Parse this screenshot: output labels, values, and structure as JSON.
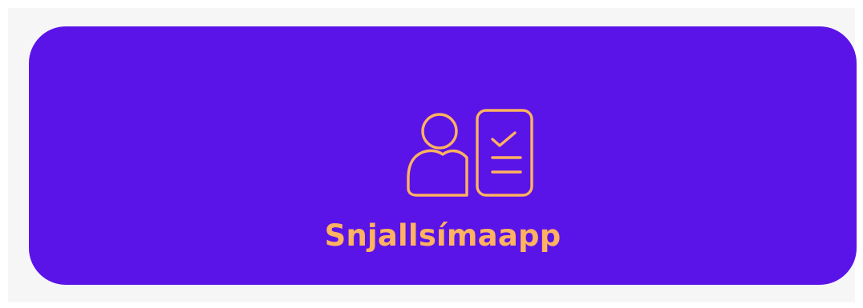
{
  "card": {
    "label": "Snjallsímaapp",
    "icon": "user-checklist-icon",
    "background_color": "#5a14e8",
    "accent_color": "#ffb25f"
  }
}
